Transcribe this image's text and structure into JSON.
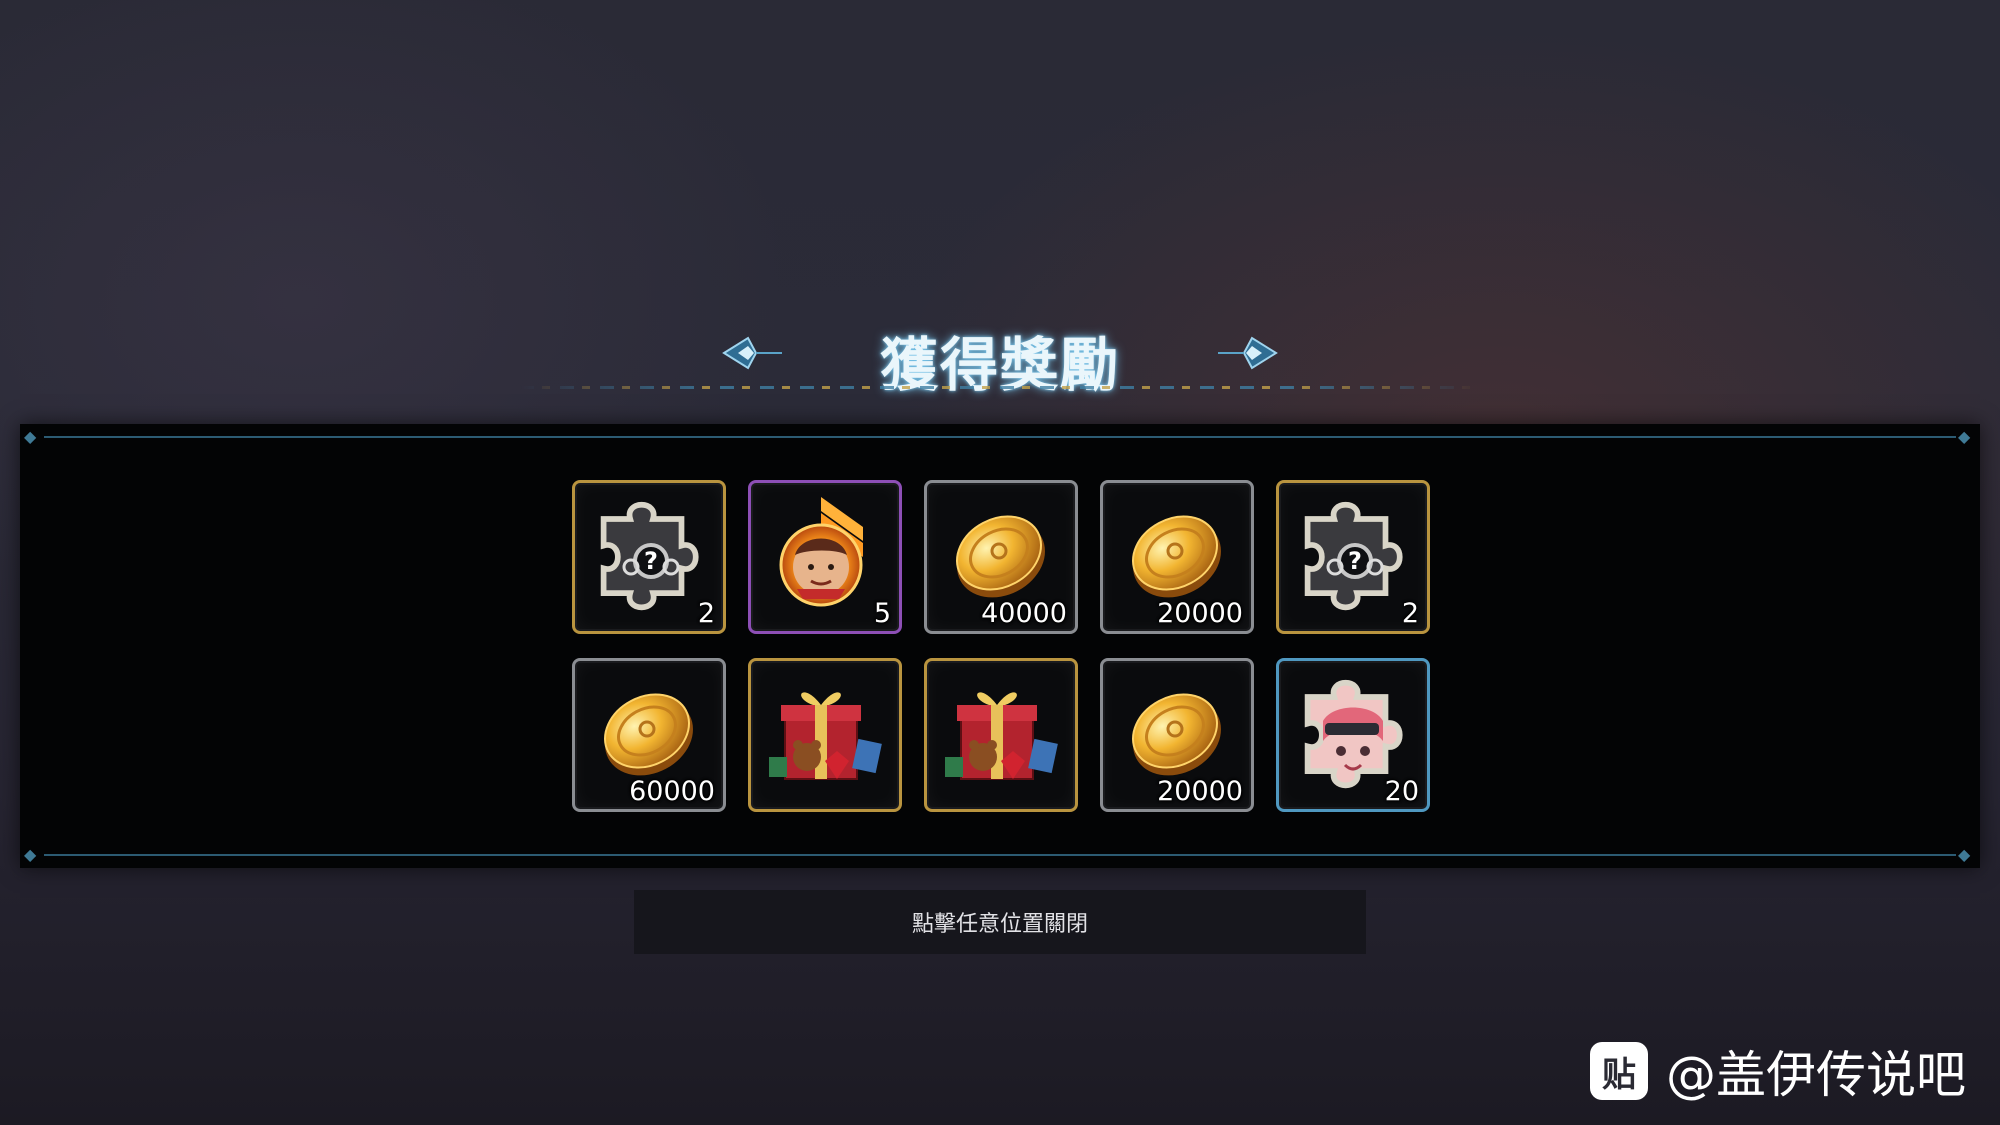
{
  "dialog": {
    "title": "獲得獎勵",
    "close_hint": "點擊任意位置關閉"
  },
  "rewards": [
    {
      "item": "puzzle-piece-hidden",
      "frame": "gold",
      "count": "2"
    },
    {
      "item": "hero-rank-up-token",
      "frame": "purple",
      "count": "5"
    },
    {
      "item": "gold-coin",
      "frame": "gray",
      "count": "40000"
    },
    {
      "item": "gold-coin",
      "frame": "gray",
      "count": "20000"
    },
    {
      "item": "puzzle-piece-hidden",
      "frame": "gold",
      "count": "2"
    },
    {
      "item": "gold-coin",
      "frame": "gray",
      "count": "60000"
    },
    {
      "item": "gift-box",
      "frame": "gold",
      "count": ""
    },
    {
      "item": "gift-box",
      "frame": "gold",
      "count": ""
    },
    {
      "item": "gold-coin",
      "frame": "gray",
      "count": "20000"
    },
    {
      "item": "puzzle-piece-character",
      "frame": "blue",
      "count": "20"
    }
  ],
  "watermark": {
    "icon_glyph": "贴",
    "text": "@盖伊传说吧"
  },
  "colors": {
    "frame_gold": "#b9943f",
    "frame_purple": "#8d4fb6",
    "frame_blue": "#4f98c0",
    "frame_gray": "#8a8d92",
    "title_glow": "#7fc8ec"
  }
}
